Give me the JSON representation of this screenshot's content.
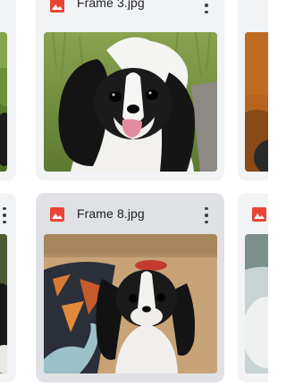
{
  "files": [
    {
      "name": "Frame 3.jpg",
      "icon": "image-file-icon",
      "state": "default"
    },
    {
      "name": "Frame 8.jpg",
      "icon": "image-file-icon",
      "state": "hovered"
    }
  ],
  "colors": {
    "card_bg": "#f1f3f4",
    "card_selected_bg": "#dfe1e5",
    "image_icon": "#ea4335",
    "text": "#202124"
  }
}
